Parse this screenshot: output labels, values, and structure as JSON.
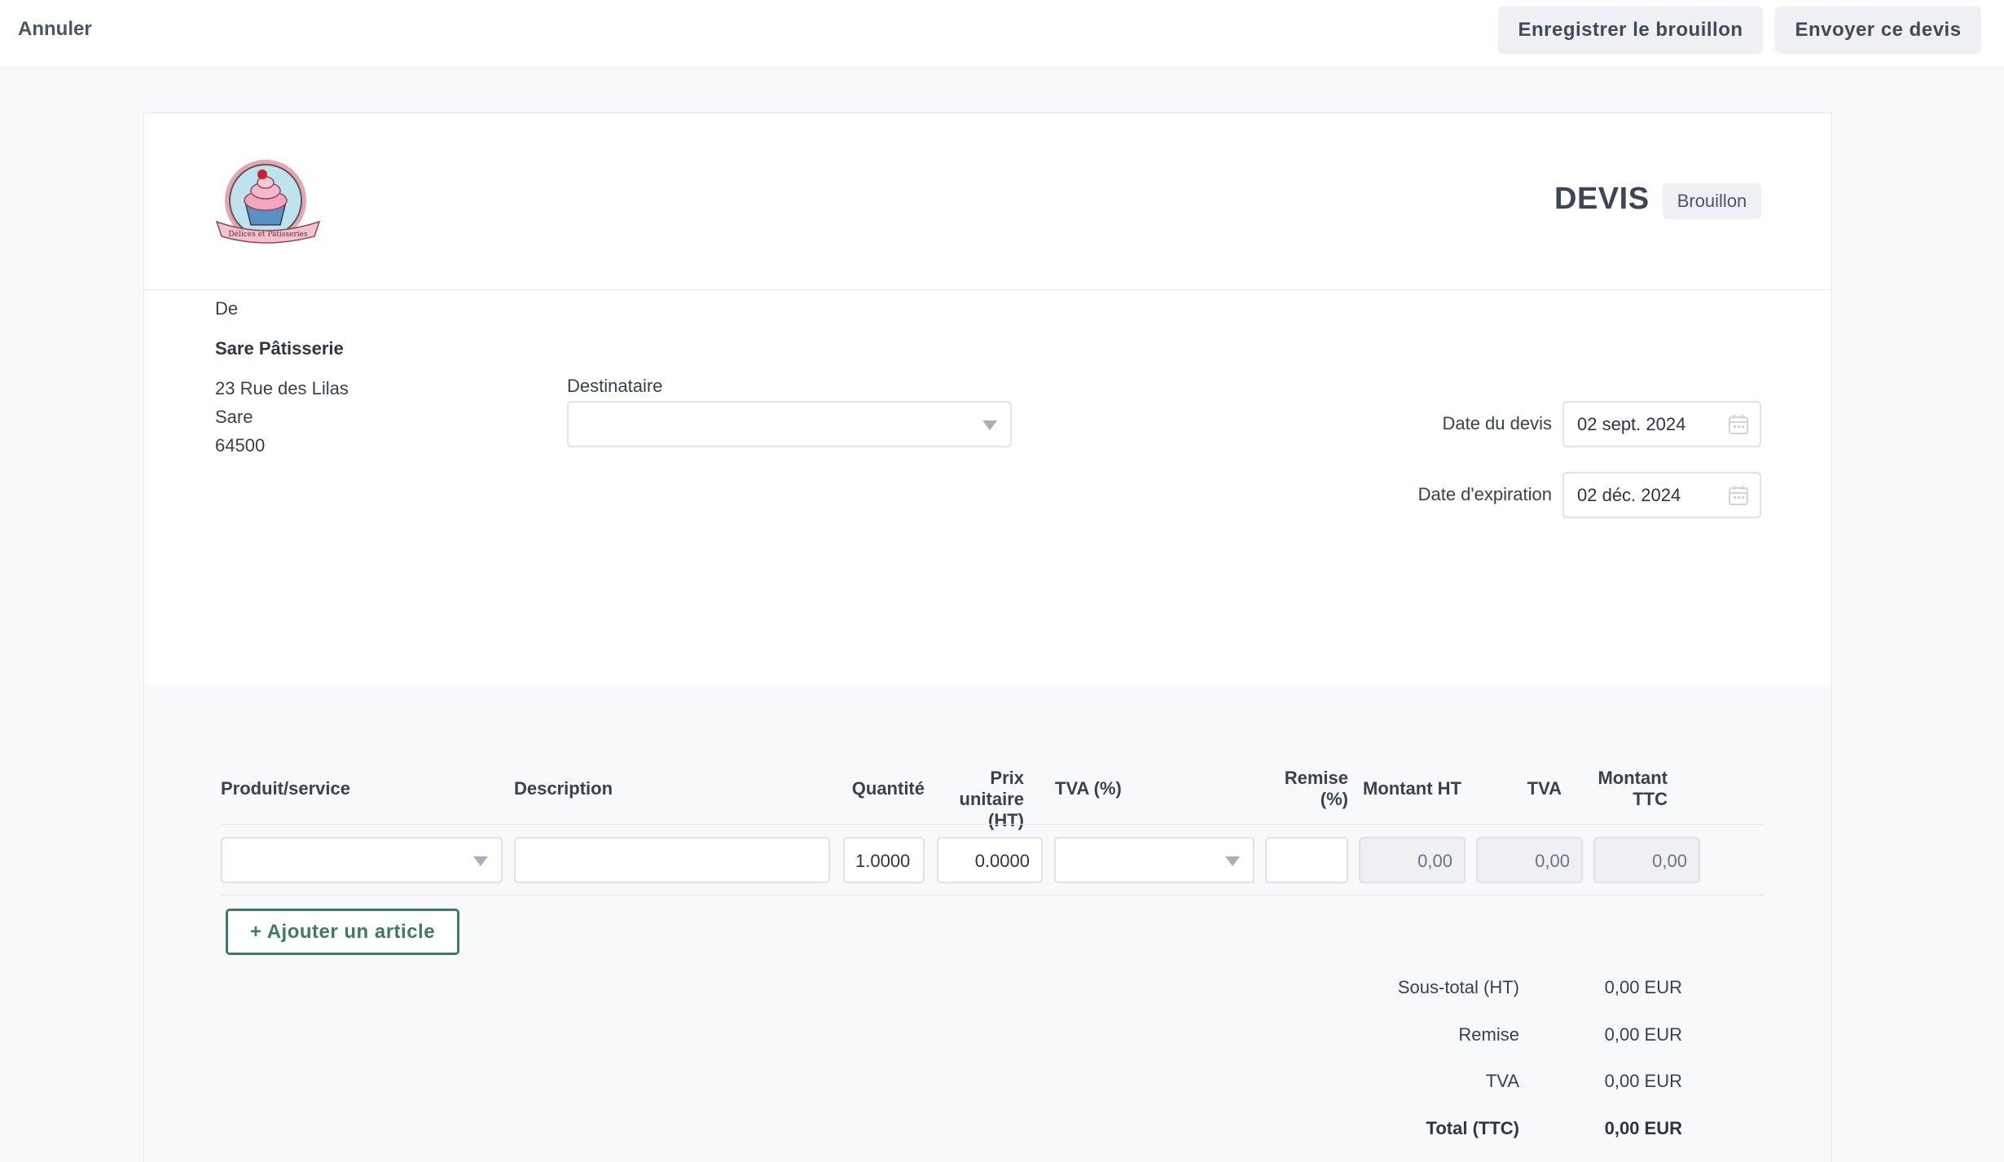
{
  "topbar": {
    "cancel_label": "Annuler",
    "save_draft_label": "Enregistrer le brouillon",
    "send_label": "Envoyer ce devis"
  },
  "header": {
    "doc_title": "DEVIS",
    "status": "Brouillon",
    "logo_text": "Délices et Pâtisseries"
  },
  "sender": {
    "label": "De",
    "name": "Sare Pâtisserie",
    "address_line": "23 Rue des Lilas",
    "city": "Sare",
    "postcode": "64500"
  },
  "recipient": {
    "label": "Destinataire",
    "value": ""
  },
  "dates": {
    "quote_label": "Date du devis",
    "quote_value": "02 sept. 2024",
    "expiry_label": "Date d'expiration",
    "expiry_value": "02 déc. 2024"
  },
  "table": {
    "headers": {
      "product": "Produit/service",
      "description": "Description",
      "quantity": "Quantité",
      "unit_price_1": "Prix unitaire",
      "unit_price_2": "(HT)",
      "vat_pct": "TVA (%)",
      "discount_1": "Remise",
      "discount_2": "(%)",
      "amount_ht": "Montant HT",
      "vat": "TVA",
      "amount_ttc_1": "Montant",
      "amount_ttc_2": "TTC"
    },
    "row": {
      "product": "",
      "description": "",
      "quantity": "1.0000",
      "unit_price": "0.0000",
      "vat_pct": "",
      "discount": "",
      "amount_ht": "0,00",
      "vat": "0,00",
      "amount_ttc": "0,00"
    },
    "add_item_label": "+ Ajouter un article"
  },
  "totals": {
    "subtotal_label": "Sous-total (HT)",
    "subtotal_value": "0,00 EUR",
    "discount_label": "Remise",
    "discount_value": "0,00 EUR",
    "vat_label": "TVA",
    "vat_value": "0,00 EUR",
    "total_label": "Total (TTC)",
    "total_value": "0,00 EUR"
  },
  "colors": {
    "accent_green": "#3d7a68",
    "button_bg": "#eef0f3",
    "page_bg": "#f8f9fa"
  }
}
